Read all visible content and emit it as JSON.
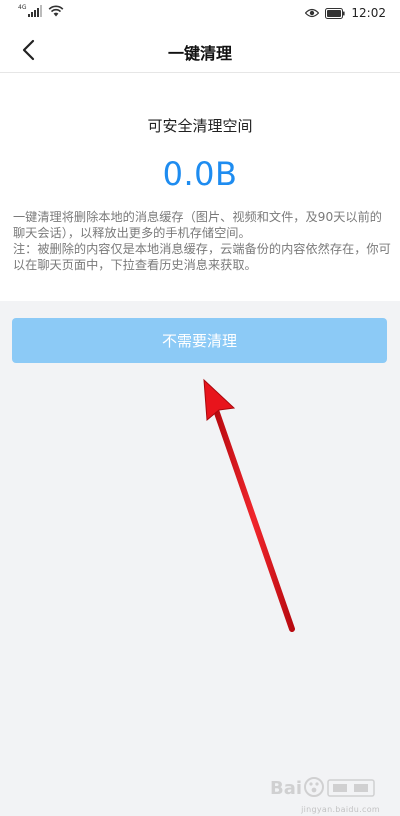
{
  "status_bar": {
    "network_type": "4G",
    "time": "12:02",
    "icons": [
      "signal-icon",
      "wifi-icon",
      "eye-icon",
      "battery-icon"
    ]
  },
  "nav": {
    "title": "一键清理",
    "back_icon": "back-chevron-icon"
  },
  "summary": {
    "label": "可安全清理空间",
    "size": "0.0B"
  },
  "description": {
    "line1": "一键清理将删除本地的消息缓存（图片、视频和文件，及90天以前的聊天会话），以释放出更多的手机存储空间。",
    "line2": "注：被删除的内容仅是本地消息缓存，云端备份的内容依然存在，你可以在聊天页面中，下拉查看历史消息来获取。"
  },
  "action": {
    "button_label": "不需要清理"
  },
  "watermark": {
    "logo": "baidu-jingyan-logo",
    "site": "jingyan.baidu.com"
  },
  "colors": {
    "accent": "#1e8cf0",
    "button_disabled": "#8ccaf6",
    "annotation_arrow": "#e8141c",
    "background": "#f2f3f5"
  }
}
